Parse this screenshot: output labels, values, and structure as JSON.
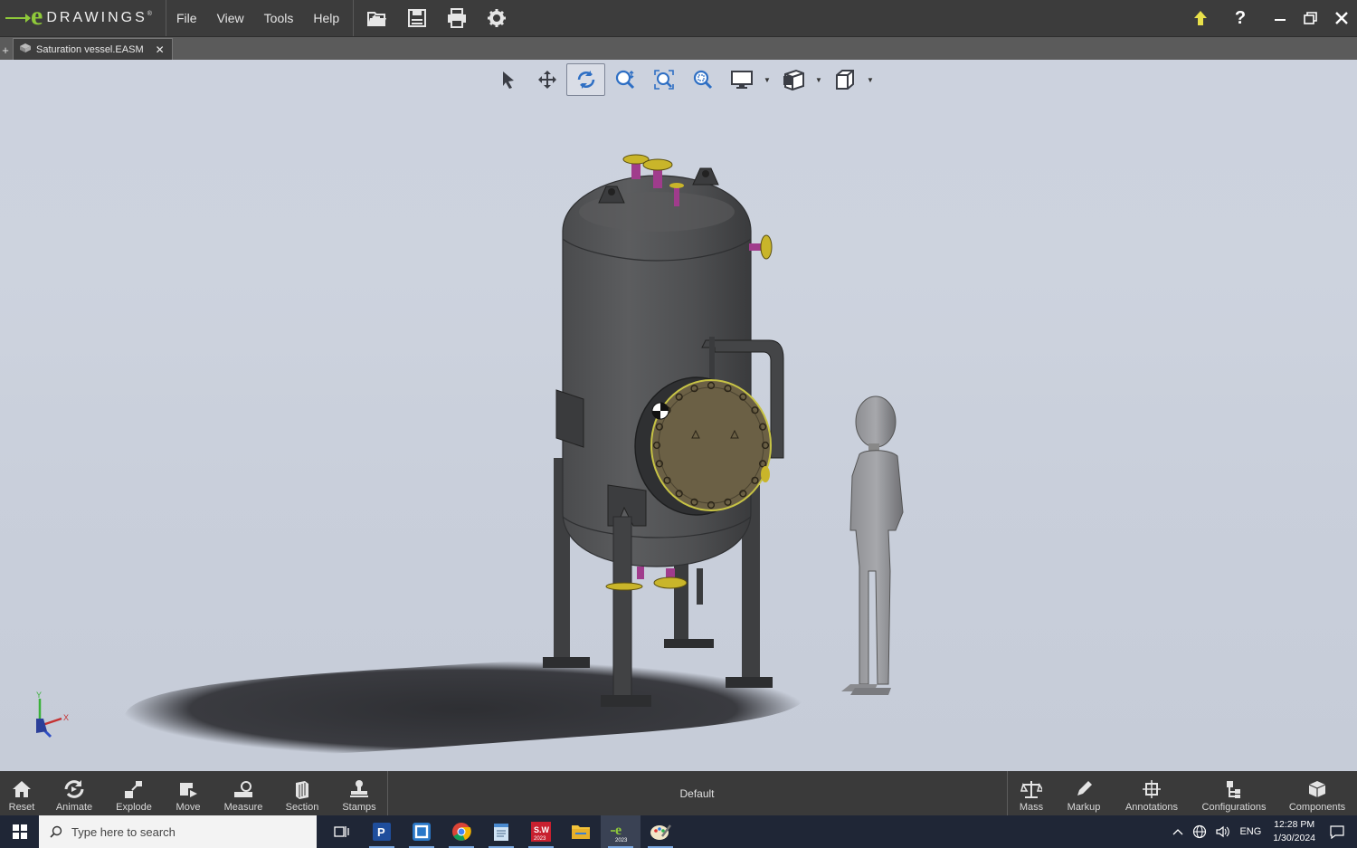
{
  "app": {
    "logo_text": "DRAWINGS",
    "menu": [
      "File",
      "View",
      "Tools",
      "Help"
    ]
  },
  "document_tab": {
    "label": "Saturation vessel.EASM",
    "add_label": "+",
    "close_label": "✕"
  },
  "view_toolbar": {
    "items": [
      "select-icon",
      "pan-icon",
      "rotate-icon",
      "zoom-icon",
      "zoom-fit-icon",
      "zoom-area-icon",
      "display-style-icon",
      "view-orientation-icon",
      "view-cube-icon"
    ],
    "active": "rotate-icon"
  },
  "triad": {
    "y_label": "Y",
    "x_label": "X"
  },
  "bottom_toolbar": {
    "left": [
      {
        "id": "reset",
        "label": "Reset"
      },
      {
        "id": "animate",
        "label": "Animate"
      },
      {
        "id": "explode",
        "label": "Explode"
      },
      {
        "id": "move",
        "label": "Move"
      },
      {
        "id": "measure",
        "label": "Measure"
      },
      {
        "id": "section",
        "label": "Section"
      },
      {
        "id": "stamps",
        "label": "Stamps"
      }
    ],
    "configuration": "Default",
    "right": [
      {
        "id": "mass",
        "label": "Mass"
      },
      {
        "id": "markup",
        "label": "Markup"
      },
      {
        "id": "annotations",
        "label": "Annotations"
      },
      {
        "id": "configurations",
        "label": "Configurations"
      },
      {
        "id": "components",
        "label": "Components"
      }
    ]
  },
  "taskbar": {
    "search_placeholder": "Type here to search",
    "apps": [
      "task-view-icon",
      "powerpoint-icon",
      "cortana-app-icon",
      "chrome-icon",
      "notepad-icon",
      "solidworks-icon",
      "file-explorer-icon",
      "edrawings-icon",
      "paint-icon"
    ],
    "sw_badge": "2023",
    "edrawings_badge": "2023",
    "tray_language": "ENG",
    "time": "12:28 PM",
    "date": "1/30/2024"
  },
  "colors": {
    "titlebar": "#3c3c3c",
    "accent_green": "#8fc93a",
    "viewport_bg": "#ccd2de",
    "taskbar": "#1f2636"
  }
}
